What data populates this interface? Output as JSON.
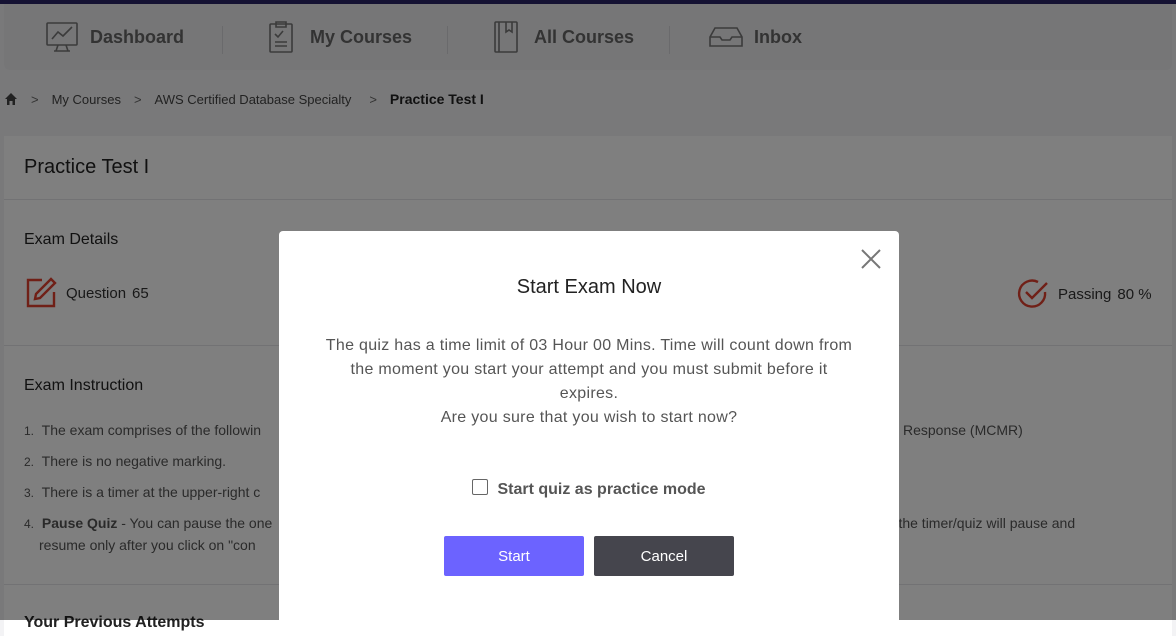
{
  "nav": {
    "items": [
      {
        "label": "Dashboard",
        "icon": "dashboard-icon"
      },
      {
        "label": "My Courses",
        "icon": "my-courses-icon"
      },
      {
        "label": "All Courses",
        "icon": "all-courses-icon"
      },
      {
        "label": "Inbox",
        "icon": "inbox-icon"
      }
    ]
  },
  "breadcrumb": {
    "home_icon": "home-icon",
    "items": [
      "My Courses",
      "AWS Certified Database Specialty"
    ],
    "current": "Practice Test I"
  },
  "page": {
    "title": "Practice Test I",
    "exam_details_title": "Exam Details",
    "question_label": "Question",
    "question_count": "65",
    "passing_label": "Passing",
    "passing_value": "80 %",
    "instruction_title": "Exam Instruction",
    "instructions": [
      {
        "num": "1.",
        "text": "The exam comprises of the followin",
        "tail": "Response (MCMR)"
      },
      {
        "num": "2.",
        "text": "There is no negative marking.",
        "tail": ""
      },
      {
        "num": "3.",
        "text": "There is a timer at the upper-right c",
        "tail": ""
      },
      {
        "num": "4.",
        "bold": "Pause Quiz",
        "text": " - You can pause the one",
        "tail": "er, the timer/quiz will pause and",
        "line2": "resume only after you click on \"con"
      }
    ],
    "partial_section": "Your Previous Attempts"
  },
  "modal": {
    "title": "Start Exam Now",
    "body_line1": "The quiz has a time limit of 03 Hour 00 Mins. Time will count down from the moment you start your attempt and you must submit before it expires.",
    "body_line2": "Are you sure that you wish to start now?",
    "practice_label": "Start quiz as practice mode",
    "start_label": "Start",
    "cancel_label": "Cancel"
  },
  "colors": {
    "accent": "#6c63ff",
    "cancel": "#45454d",
    "icon_red": "#e0412f",
    "topbar": "#2a2466"
  }
}
